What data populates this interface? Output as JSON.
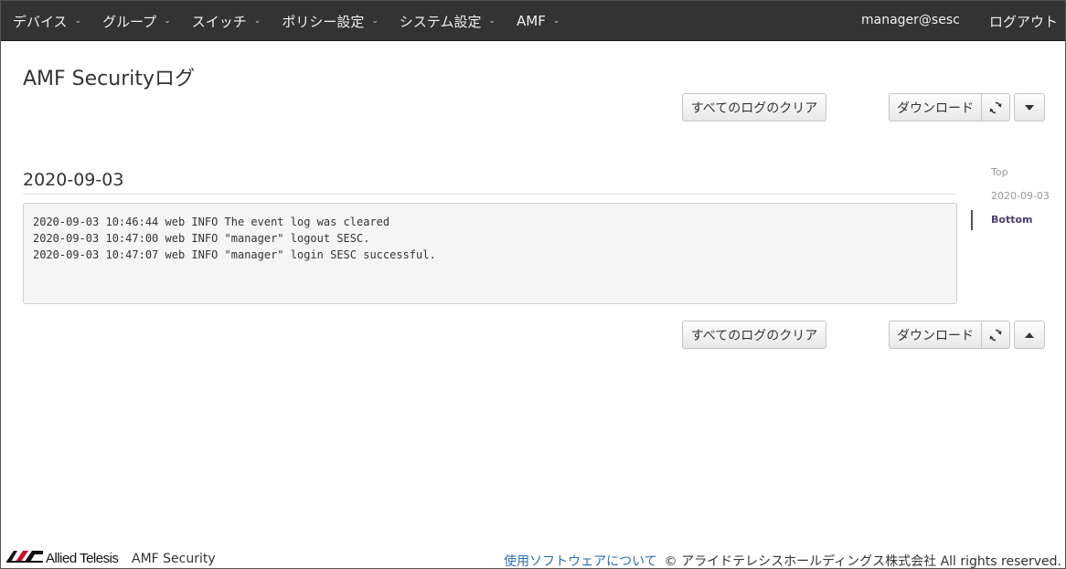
{
  "nav": {
    "items": [
      {
        "label": "デバイス"
      },
      {
        "label": "グループ"
      },
      {
        "label": "スイッチ"
      },
      {
        "label": "ポリシー設定"
      },
      {
        "label": "システム設定"
      },
      {
        "label": "AMF"
      }
    ],
    "user": "manager@sesc",
    "logout": "ログアウト"
  },
  "page": {
    "title": "AMF Securityログ"
  },
  "toolbar_top": {
    "clear_label": "すべてのログのクリア",
    "download_label": "ダウンロード",
    "refresh_icon": "refresh-icon",
    "dropdown_icon": "caret-down-icon"
  },
  "log_section": {
    "date": "2020-09-03",
    "lines": [
      "2020-09-03 10:46:44 web INFO The event log was cleared",
      "2020-09-03 10:47:00 web INFO \"manager\" logout SESC.",
      "2020-09-03 10:47:07 web INFO \"manager\" login SESC successful."
    ]
  },
  "toolbar_bottom": {
    "clear_label": "すべてのログのクリア",
    "download_label": "ダウンロード",
    "refresh_icon": "refresh-icon",
    "up_icon": "caret-up-icon"
  },
  "side_nav": {
    "items": [
      {
        "label": "Top"
      },
      {
        "label": "2020-09-03"
      },
      {
        "label": "Bottom"
      }
    ],
    "active_color": "#4a3d6b"
  },
  "footer": {
    "brand": "Allied Telesis",
    "product": "AMF Security",
    "about_link": "使用ソフトウェアについて",
    "copyright": "© アライドテレシスホールディングス株式会社 All rights reserved."
  },
  "colors": {
    "navbar": "#333333",
    "link": "#2a6fb0",
    "log_bg": "#f5f5f5"
  }
}
